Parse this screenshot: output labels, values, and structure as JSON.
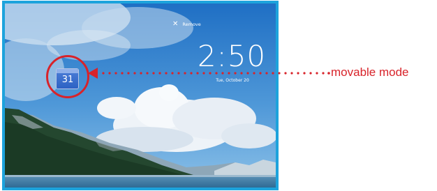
{
  "screen": {
    "remove_label": "Remove",
    "remove_icon": "close-icon",
    "clock_time": "2:50",
    "date_text": "Tue, October 20",
    "app_icon": "calendar-icon",
    "calendar_day": "31"
  },
  "annotation": {
    "label": "movable mode",
    "color": "#d8232a",
    "frame_color": "#1da3dc"
  }
}
